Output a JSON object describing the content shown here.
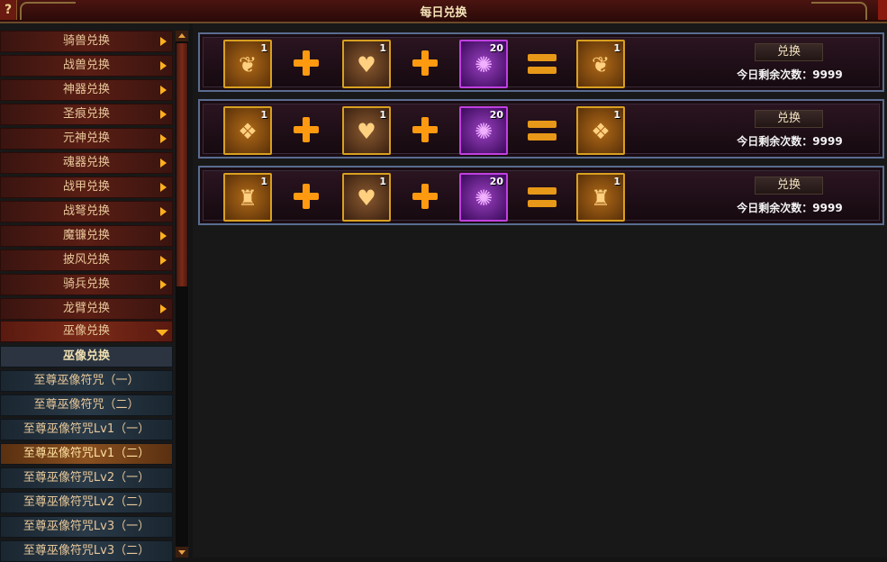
{
  "window": {
    "title": "每日兑换",
    "help": "?"
  },
  "sidebar": {
    "categories": [
      {
        "label": "骑兽兑换"
      },
      {
        "label": "战兽兑换"
      },
      {
        "label": "神器兑换"
      },
      {
        "label": "圣痕兑换"
      },
      {
        "label": "元神兑换"
      },
      {
        "label": "魂器兑换"
      },
      {
        "label": "战甲兑换"
      },
      {
        "label": "战弩兑换"
      },
      {
        "label": "魔镰兑换"
      },
      {
        "label": "披风兑换"
      },
      {
        "label": "骑兵兑换"
      },
      {
        "label": "龙臂兑换"
      },
      {
        "label": "巫像兑换"
      }
    ],
    "active_category": "巫像兑换",
    "subitems": [
      {
        "label": "巫像兑换"
      },
      {
        "label": "至尊巫像符咒（一）"
      },
      {
        "label": "至尊巫像符咒（二）"
      },
      {
        "label": "至尊巫像符咒Lv1（一）"
      },
      {
        "label": "至尊巫像符咒Lv1（二）"
      },
      {
        "label": "至尊巫像符咒Lv2（一）"
      },
      {
        "label": "至尊巫像符咒Lv2（二）"
      },
      {
        "label": "至尊巫像符咒Lv3（一）"
      },
      {
        "label": "至尊巫像符咒Lv3（二）"
      }
    ],
    "selected_subitem": "至尊巫像符咒Lv1（二）"
  },
  "exchanges": [
    {
      "inputs": [
        {
          "count": "1",
          "icon": "heart-charm-icon"
        },
        {
          "count": "1",
          "icon": "heart-card-icon"
        },
        {
          "count": "20",
          "icon": "purple-rune-icon"
        }
      ],
      "output": {
        "count": "1",
        "icon": "heart-charm-icon"
      },
      "button": "兑换",
      "remaining": "今日剩余次数：9999"
    },
    {
      "inputs": [
        {
          "count": "1",
          "icon": "crystal-charm-icon"
        },
        {
          "count": "1",
          "icon": "heart-card-icon"
        },
        {
          "count": "20",
          "icon": "purple-rune-icon"
        }
      ],
      "output": {
        "count": "1",
        "icon": "crystal-charm-icon"
      },
      "button": "兑换",
      "remaining": "今日剩余次数：9999"
    },
    {
      "inputs": [
        {
          "count": "1",
          "icon": "totem-charm-icon"
        },
        {
          "count": "1",
          "icon": "heart-card-icon"
        },
        {
          "count": "20",
          "icon": "purple-rune-icon"
        }
      ],
      "output": {
        "count": "1",
        "icon": "totem-charm-icon"
      },
      "button": "兑换",
      "remaining": "今日剩余次数：9999"
    }
  ],
  "colors": {
    "accent": "#ff9a10",
    "rare_border": "#d8a020",
    "epic_border": "#c040e0",
    "row_border": "#5a6c90"
  }
}
